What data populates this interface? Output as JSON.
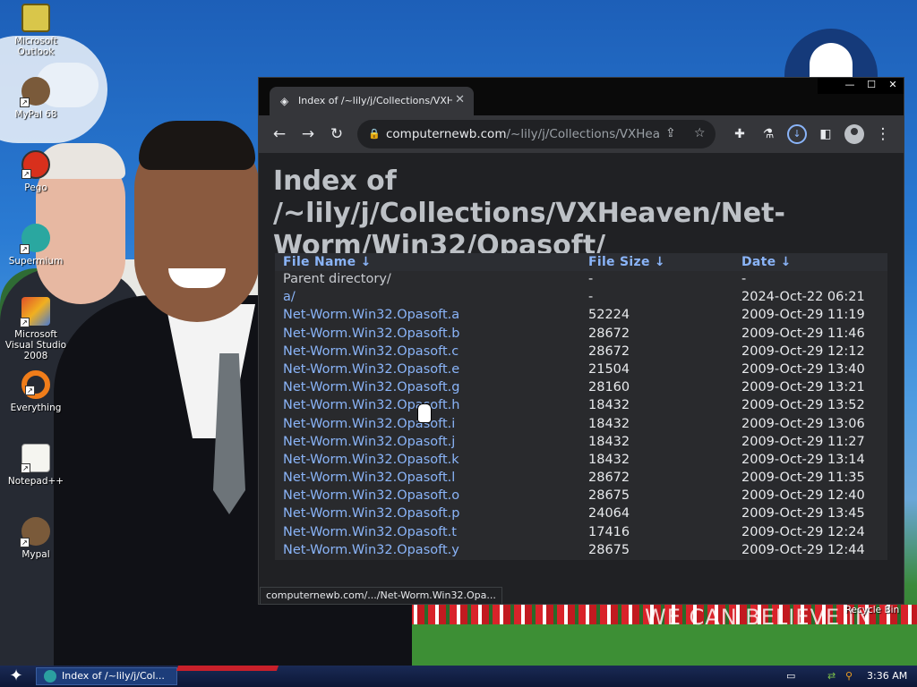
{
  "desktop": {
    "slogan": "WE CAN BELIEVE IN",
    "icons": [
      {
        "label": "Microsoft Outlook",
        "icon": "outlook-icon",
        "color": "#d9c64a"
      },
      {
        "label": "MyPal 68",
        "icon": "mypal-icon",
        "color": "#7a5a3a"
      },
      {
        "label": "Pego",
        "icon": "pego-icon",
        "color": "#d8301c"
      },
      {
        "label": "Supermium",
        "icon": "supermium-icon",
        "color": "#2aa7a0"
      },
      {
        "label": "Microsoft Visual Studio 2008",
        "icon": "visual-studio-icon",
        "color": "#e0502a"
      },
      {
        "label": "Everything",
        "icon": "everything-icon",
        "color": "#f07d1a"
      },
      {
        "label": "Notepad++",
        "icon": "notepadpp-icon",
        "color": "#7cc04a"
      },
      {
        "label": "Mypal",
        "icon": "mypal-icon",
        "color": "#7a5a3a"
      }
    ],
    "recycle_bin": "Recycle Bin"
  },
  "browser": {
    "tab_title": "Index of /~lily/j/Collections/VXHeaven",
    "url_host": "computernewb.com",
    "url_path": "/~lily/j/Collections/VXHeave...",
    "status_url": "computernewb.com/.../Net-Worm.Win32.Opa...",
    "window_buttons": {
      "minimize": "—",
      "maximize": "☐",
      "close": "✕"
    }
  },
  "page": {
    "heading": "Index of /~lily/j/Collections/VXHeaven/Net-Worm/Win32/Opasoft/",
    "columns": {
      "name": "File Name  ↓",
      "size": "File Size  ↓",
      "date": "Date  ↓"
    },
    "rows": [
      {
        "name": "Parent directory/",
        "size": "-",
        "date": "-"
      },
      {
        "name": "a/",
        "size": "-",
        "date": "2024-Oct-22 06:21"
      },
      {
        "name": "Net-Worm.Win32.Opasoft.a",
        "size": "52224",
        "date": "2009-Oct-29 11:19"
      },
      {
        "name": "Net-Worm.Win32.Opasoft.b",
        "size": "28672",
        "date": "2009-Oct-29 11:46"
      },
      {
        "name": "Net-Worm.Win32.Opasoft.c",
        "size": "28672",
        "date": "2009-Oct-29 12:12"
      },
      {
        "name": "Net-Worm.Win32.Opasoft.e",
        "size": "21504",
        "date": "2009-Oct-29 13:40"
      },
      {
        "name": "Net-Worm.Win32.Opasoft.g",
        "size": "28160",
        "date": "2009-Oct-29 13:21"
      },
      {
        "name": "Net-Worm.Win32.Opasoft.h",
        "size": "18432",
        "date": "2009-Oct-29 13:52"
      },
      {
        "name": "Net-Worm.Win32.Opasoft.i",
        "size": "18432",
        "date": "2009-Oct-29 13:06"
      },
      {
        "name": "Net-Worm.Win32.Opasoft.j",
        "size": "18432",
        "date": "2009-Oct-29 11:27"
      },
      {
        "name": "Net-Worm.Win32.Opasoft.k",
        "size": "18432",
        "date": "2009-Oct-29 13:14"
      },
      {
        "name": "Net-Worm.Win32.Opasoft.l",
        "size": "28672",
        "date": "2009-Oct-29 11:35"
      },
      {
        "name": "Net-Worm.Win32.Opasoft.o",
        "size": "28675",
        "date": "2009-Oct-29 12:40"
      },
      {
        "name": "Net-Worm.Win32.Opasoft.p",
        "size": "24064",
        "date": "2009-Oct-29 13:45"
      },
      {
        "name": "Net-Worm.Win32.Opasoft.t",
        "size": "17416",
        "date": "2009-Oct-29 12:24"
      },
      {
        "name": "Net-Worm.Win32.Opasoft.y",
        "size": "28675",
        "date": "2009-Oct-29 12:44"
      }
    ]
  },
  "taskbar": {
    "task_label": "Index of /~lily/j/Col...",
    "clock": "3:36 AM"
  },
  "colors": {
    "link": "#8ab4f8",
    "page_bg": "#202124",
    "toolbar_bg": "#35363a"
  }
}
